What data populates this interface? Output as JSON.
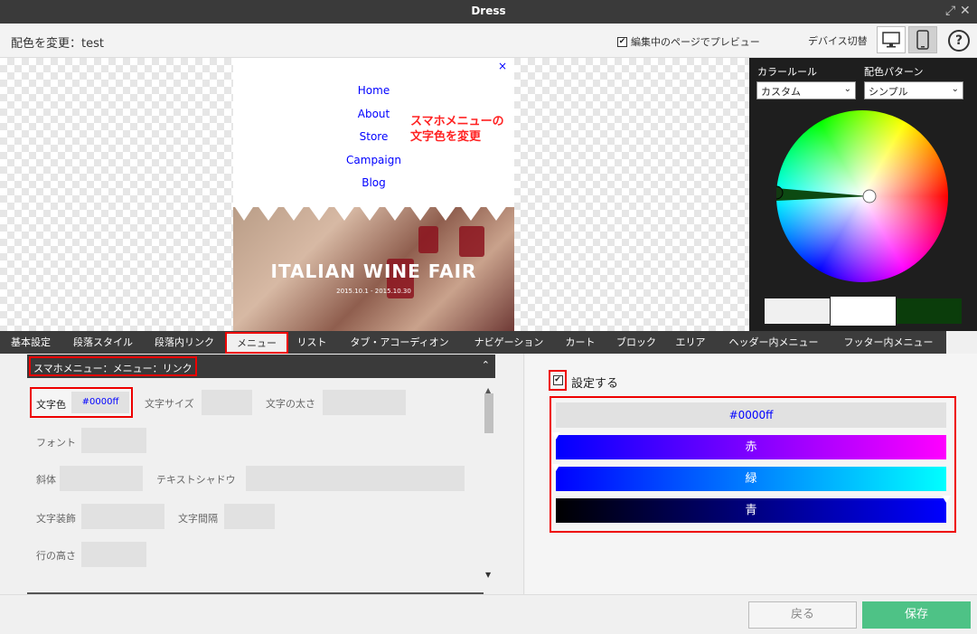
{
  "window": {
    "title": "Dress"
  },
  "header": {
    "page_title": "配色を変更：test",
    "preview_check_label": "編集中のページでプレビュー",
    "device_toggle_label": "デバイス切替",
    "help_label": "?"
  },
  "preview": {
    "close_glyph": "×",
    "menu_links": [
      "Home",
      "About",
      "Store",
      "Campaign",
      "Blog"
    ],
    "annotation_line1": "スマホメニューの",
    "annotation_line2": "文字色を変更",
    "banner_title": "ITALIAN WINE FAIR",
    "banner_date": "2015.10.1 - 2015.10.30"
  },
  "color_panel": {
    "rule_label": "カラールール",
    "rule_value": "カスタム",
    "pattern_label": "配色パターン",
    "pattern_value": "シンプル",
    "swatches": [
      "#f0f0f0",
      "#ffffff",
      "#0b3d0b"
    ]
  },
  "tabs": [
    "基本設定",
    "段落スタイル",
    "段落内リンク",
    "メニュー",
    "リスト",
    "タブ・アコーディオン",
    "ナビゲーション",
    "カート",
    "ブロック",
    "エリア",
    "ヘッダー内メニュー",
    "フッター内メニュー"
  ],
  "active_tab": "メニュー",
  "section": {
    "title": "スマホメニュー：メニュー：リンク",
    "color_label": "文字色",
    "color_value": "#0000ff",
    "size_label": "文字サイズ",
    "weight_label": "文字の太さ",
    "font_label": "フォント",
    "italic_label": "斜体",
    "shadow_label": "テキストシャドウ",
    "decoration_label": "文字装飾",
    "spacing_label": "文字間隔",
    "lineheight_label": "行の高さ"
  },
  "editor": {
    "set_label": "設定する",
    "hex": "#0000ff",
    "sliders": [
      {
        "label": "赤",
        "value": 0
      },
      {
        "label": "緑",
        "value": 0
      },
      {
        "label": "青",
        "value": 255
      }
    ]
  },
  "footer": {
    "back_label": "戻る",
    "save_label": "保存"
  },
  "colors": {
    "accent": "#4ec286",
    "highlight": "#ee0000",
    "link": "#0000ff",
    "dark": "#3a3a3a"
  }
}
